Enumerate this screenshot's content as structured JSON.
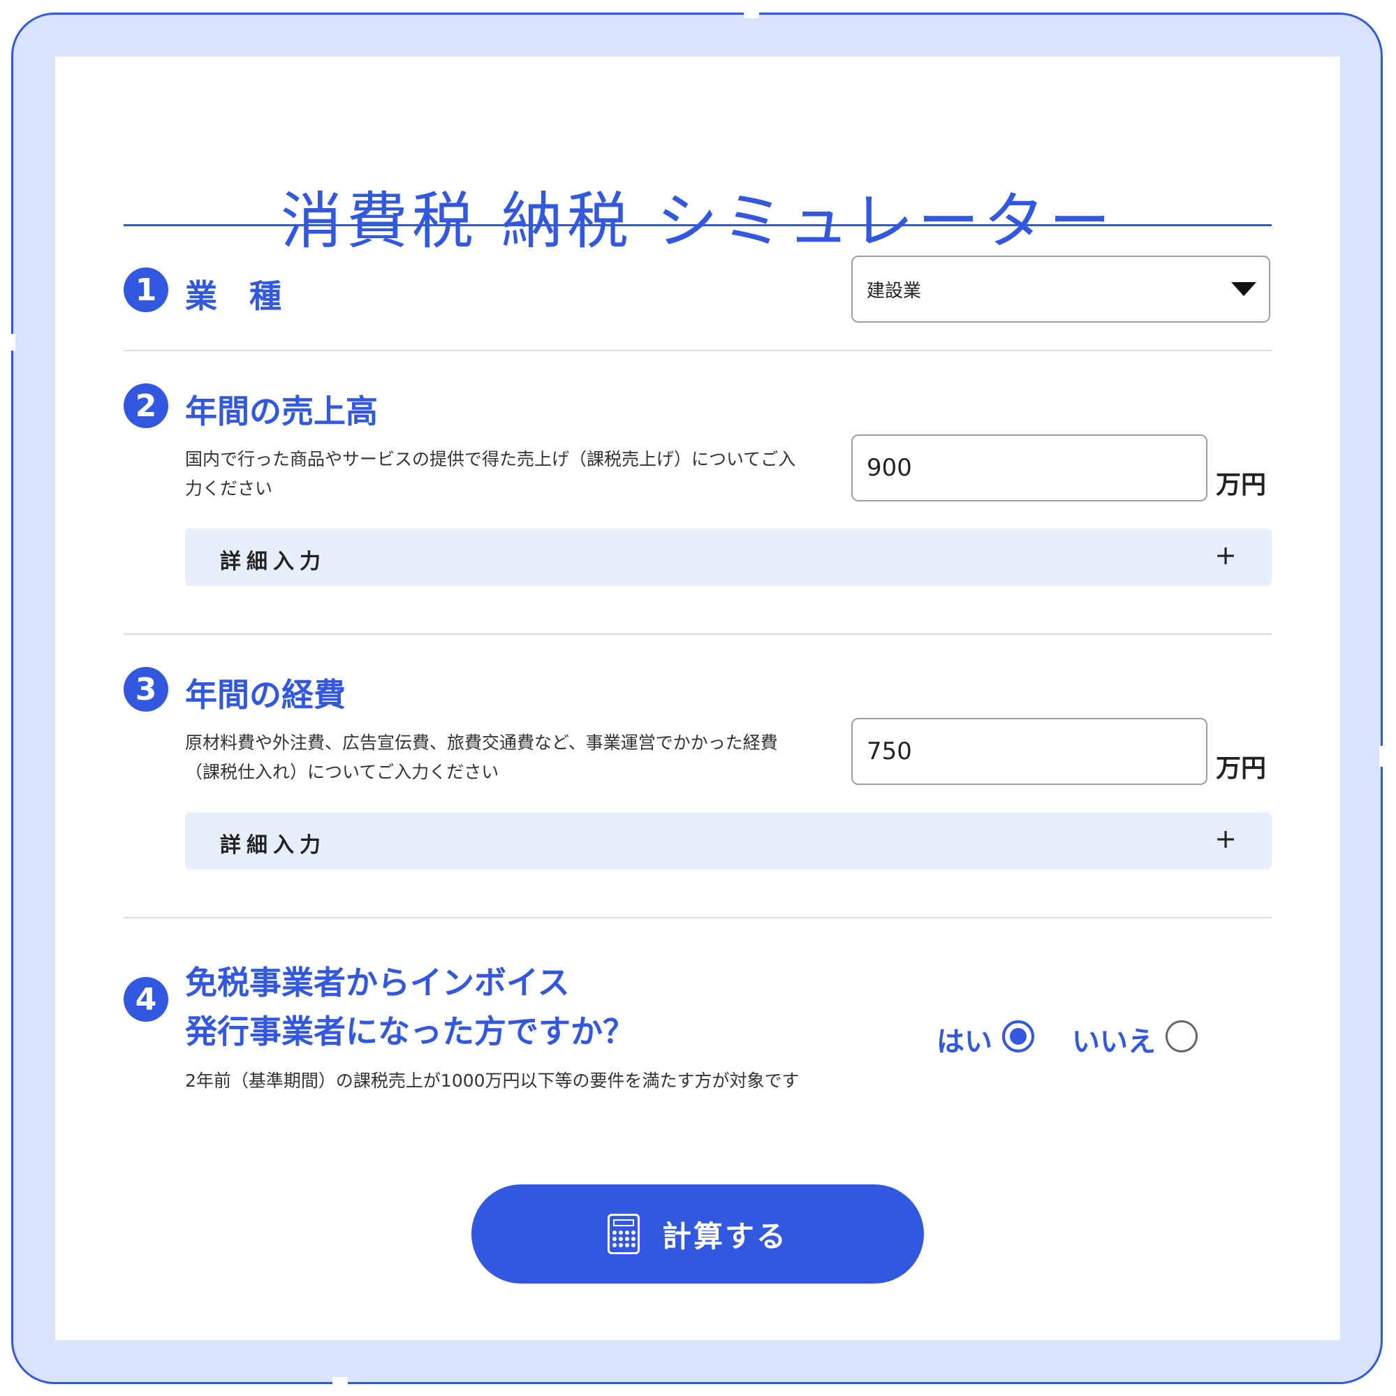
{
  "title": "消費税 納税 シミュレーター",
  "sections": {
    "industry": {
      "badge": "1",
      "heading": "業　種",
      "selected": "建設業"
    },
    "sales": {
      "badge": "2",
      "heading": "年間の売上高",
      "description": "国内で行った商品やサービスの提供で得た売上げ（課税売上げ）についてご入力ください",
      "value": "900",
      "unit": "万円",
      "detail_label": "詳細入力",
      "detail_toggle": "+"
    },
    "expenses": {
      "badge": "3",
      "heading": "年間の経費",
      "description": "原材料費や外注費、広告宣伝費、旅費交通費など、事業運営でかかった経費（課税仕入れ）についてご入力ください",
      "value": "750",
      "unit": "万円",
      "detail_label": "詳細入力",
      "detail_toggle": "+"
    },
    "invoice": {
      "badge": "4",
      "heading_line1": "免税事業者からインボイス",
      "heading_line2": "発行事業者になった方ですか？",
      "description": "2年前（基準期間）の課税売上が1000万円以下等の要件を満たす方が対象です",
      "yes_label": "はい",
      "no_label": "いいえ",
      "selected": "はい"
    }
  },
  "calculate_button": {
    "label": "計算する",
    "icon": "calculator-icon"
  },
  "colors": {
    "accent": "#3358e0",
    "frame_bg": "#d9e3fb",
    "detail_bg": "#e8eefc"
  }
}
